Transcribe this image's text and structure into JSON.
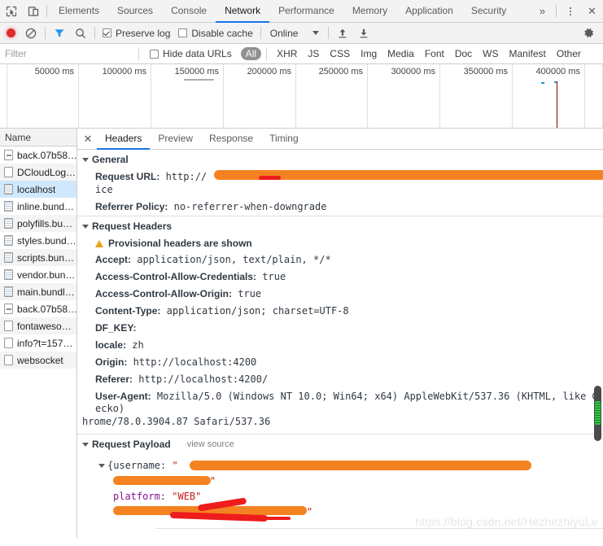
{
  "window": {
    "tabs": [
      {
        "label": "Elements",
        "active": false
      },
      {
        "label": "Sources",
        "active": false
      },
      {
        "label": "Console",
        "active": false
      },
      {
        "label": "Network",
        "active": true
      },
      {
        "label": "Performance",
        "active": false
      },
      {
        "label": "Memory",
        "active": false
      },
      {
        "label": "Application",
        "active": false
      },
      {
        "label": "Security",
        "active": false
      }
    ],
    "more_label": "»",
    "close_label": "✕",
    "inspect_icon": "inspect-element-icon",
    "device_icon": "device-toolbar-icon",
    "menu_icon": "kebab-menu-icon"
  },
  "controls": {
    "record_icon": "record-button",
    "clear_icon": "clear-button",
    "filter_icon": "filter-funnel-icon",
    "search_icon": "search-icon",
    "preserve_log": {
      "label": "Preserve log",
      "checked": true
    },
    "disable_cache": {
      "label": "Disable cache",
      "checked": false
    },
    "throttle": {
      "value": "Online",
      "caret": "▼"
    },
    "import_icon": "import-har-icon",
    "export_icon": "export-har-icon",
    "settings_icon": "gear-icon"
  },
  "filters": {
    "placeholder": "Filter",
    "value": "",
    "hide_data_urls": {
      "label": "Hide data URLs",
      "checked": false
    },
    "types": [
      {
        "label": "All",
        "selected": true
      },
      {
        "label": "XHR",
        "selected": false
      },
      {
        "label": "JS",
        "selected": false
      },
      {
        "label": "CSS",
        "selected": false
      },
      {
        "label": "Img",
        "selected": false
      },
      {
        "label": "Media",
        "selected": false
      },
      {
        "label": "Font",
        "selected": false
      },
      {
        "label": "Doc",
        "selected": false
      },
      {
        "label": "WS",
        "selected": false
      },
      {
        "label": "Manifest",
        "selected": false
      },
      {
        "label": "Other",
        "selected": false
      }
    ]
  },
  "overview": {
    "ticks": [
      "50000 ms",
      "100000 ms",
      "150000 ms",
      "200000 ms",
      "250000 ms",
      "300000 ms",
      "350000 ms",
      "400000 ms"
    ]
  },
  "requests": {
    "column_header": "Name",
    "rows": [
      {
        "name": "back.07b58…",
        "icon": "image-file-icon",
        "selected": false
      },
      {
        "name": "DCloudLog…",
        "icon": "document-file-icon",
        "selected": false
      },
      {
        "name": "localhost",
        "icon": "text-file-icon",
        "selected": true
      },
      {
        "name": "inline.bund…",
        "icon": "text-file-icon",
        "selected": false
      },
      {
        "name": "polyfills.bu…",
        "icon": "text-file-icon",
        "selected": false
      },
      {
        "name": "styles.bund…",
        "icon": "text-file-icon",
        "selected": false
      },
      {
        "name": "scripts.bun…",
        "icon": "text-file-icon",
        "selected": false
      },
      {
        "name": "vendor.bun…",
        "icon": "text-file-icon",
        "selected": false
      },
      {
        "name": "main.bundl…",
        "icon": "text-file-icon",
        "selected": false
      },
      {
        "name": "back.07b58…",
        "icon": "image-file-icon",
        "selected": false
      },
      {
        "name": "fontaweso…",
        "icon": "document-file-icon",
        "selected": false
      },
      {
        "name": "info?t=157…",
        "icon": "document-file-icon",
        "selected": false
      },
      {
        "name": "websocket",
        "icon": "document-file-icon",
        "selected": false
      }
    ]
  },
  "detail": {
    "close_label": "✕",
    "tabs": [
      {
        "label": "Headers",
        "active": true
      },
      {
        "label": "Preview",
        "active": false
      },
      {
        "label": "Response",
        "active": false
      },
      {
        "label": "Timing",
        "active": false
      }
    ],
    "general": {
      "title": "General",
      "request_url_key": "Request URL:",
      "request_url_value": "http://",
      "request_url_wrap": "ice",
      "referrer_policy_key": "Referrer Policy:",
      "referrer_policy_value": "no-referrer-when-downgrade"
    },
    "request_headers": {
      "title": "Request Headers",
      "provisional_notice": "Provisional headers are shown",
      "items": [
        {
          "key": "Accept:",
          "value": "application/json, text/plain, */*"
        },
        {
          "key": "Access-Control-Allow-Credentials:",
          "value": "true"
        },
        {
          "key": "Access-Control-Allow-Origin:",
          "value": "true"
        },
        {
          "key": "Content-Type:",
          "value": "application/json; charset=UTF-8"
        },
        {
          "key": "DF_KEY:",
          "value": ""
        },
        {
          "key": "locale:",
          "value": "zh"
        },
        {
          "key": "Origin:",
          "value": "http://localhost:4200"
        },
        {
          "key": "Referer:",
          "value": "http://localhost:4200/"
        },
        {
          "key": "User-Agent:",
          "value": "Mozilla/5.0 (Windows NT 10.0; Win64; x64) AppleWebKit/537.36 (KHTML, like Gecko)"
        },
        {
          "key": "",
          "value": "hrome/78.0.3904.87 Safari/537.36"
        }
      ]
    },
    "payload": {
      "title": "Request Payload",
      "view_source": "view source",
      "lines": [
        {
          "prefix": "{username: ",
          "quote": "\"",
          "redacted": true,
          "suffix": "}"
        },
        {
          "prefix": "",
          "quote": "",
          "redacted": true,
          "suffix": "\""
        },
        {
          "prefix": "platform: ",
          "quote": "",
          "value": "\"WEB\"",
          "redacted": false,
          "suffix": ""
        },
        {
          "prefix": "",
          "quote": "",
          "redacted": true,
          "suffix": "\""
        }
      ]
    }
  },
  "watermark": "https://blog.csdn.net/HezhezhiyuLe",
  "colors": {
    "accent": "#1a73e8",
    "record": "#e02a2a",
    "selection": "#cfe8fc",
    "redaction": "#f58220",
    "redaction_red": "#ee1c1c",
    "warning": "#e8a317"
  }
}
